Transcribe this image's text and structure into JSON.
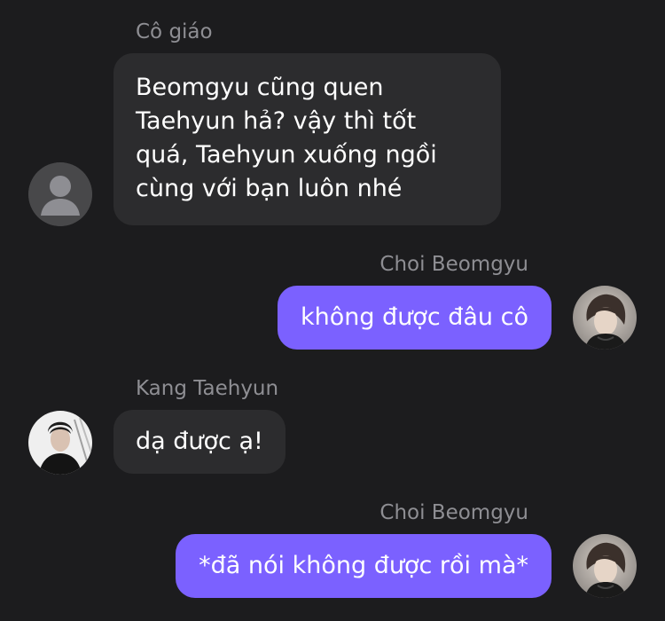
{
  "messages": [
    {
      "sender": "Cô giáo",
      "direction": "incoming",
      "lines": [
        "Beomgyu cũng quen",
        "Taehyun hả? vậy thì tốt",
        "quá, Taehyun xuống ngồi",
        "cùng với bạn luôn nhé"
      ],
      "avatar": "default-avatar-icon"
    },
    {
      "sender": "Choi Beomgyu",
      "direction": "outgoing",
      "text": "không được đâu cô",
      "avatar": "beomgyu-photo"
    },
    {
      "sender": "Kang Taehyun",
      "direction": "incoming",
      "text": "dạ được ạ!",
      "avatar": "taehyun-photo"
    },
    {
      "sender": "Choi Beomgyu",
      "direction": "outgoing",
      "text": "*đã nói không được rồi mà*",
      "avatar": "beomgyu-photo"
    }
  ],
  "colors": {
    "background": "#1c1c1e",
    "incoming_bubble": "#2c2c2e",
    "outgoing_bubble": "#7b61ff",
    "sender_label": "#8e8e93",
    "message_text": "#ffffff"
  }
}
